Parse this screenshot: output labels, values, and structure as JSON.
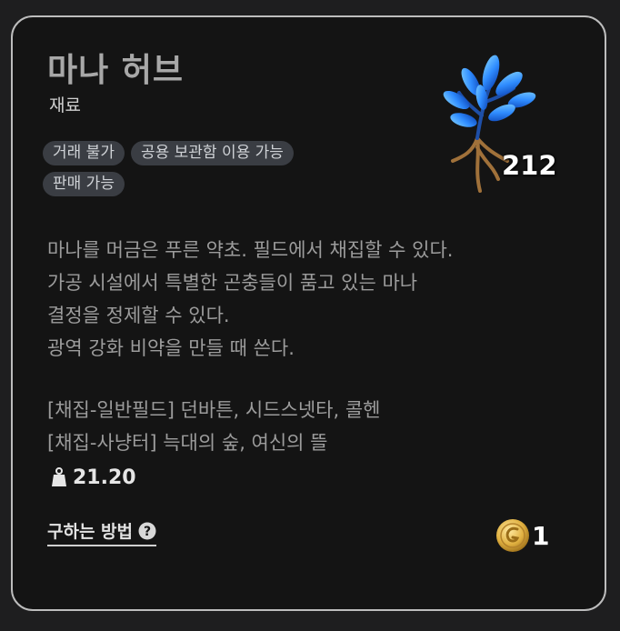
{
  "item": {
    "name": "마나 허브",
    "category": "재료",
    "tags": [
      "거래 불가",
      "공용 보관함 이용 가능",
      "판매 가능"
    ],
    "count": "212",
    "description": [
      "마나를 머금은 푸른 약초. 필드에서 채집할 수 있다.",
      "가공 시설에서 특별한 곤충들이 품고 있는 마나",
      "결정을 정제할 수 있다.",
      "광역 강화 비약을 만들 때 쓴다."
    ],
    "sources": [
      "[채집-일반필드] 던바튼, 시드스넷타, 콜헨",
      "[채집-사냥터] 늑대의 숲, 여신의 뜰"
    ],
    "weight": "21.20",
    "how_to_obtain_label": "구하는 방법",
    "price": "1",
    "icons": {
      "item": "mana-herb-icon",
      "weight": "weight-icon",
      "help": "question-circle-icon",
      "coin": "gold-coin-icon"
    },
    "colors": {
      "accent": "#2f8cff",
      "tag_bg": "#3a3d43",
      "coin": "#d9a93a"
    }
  }
}
